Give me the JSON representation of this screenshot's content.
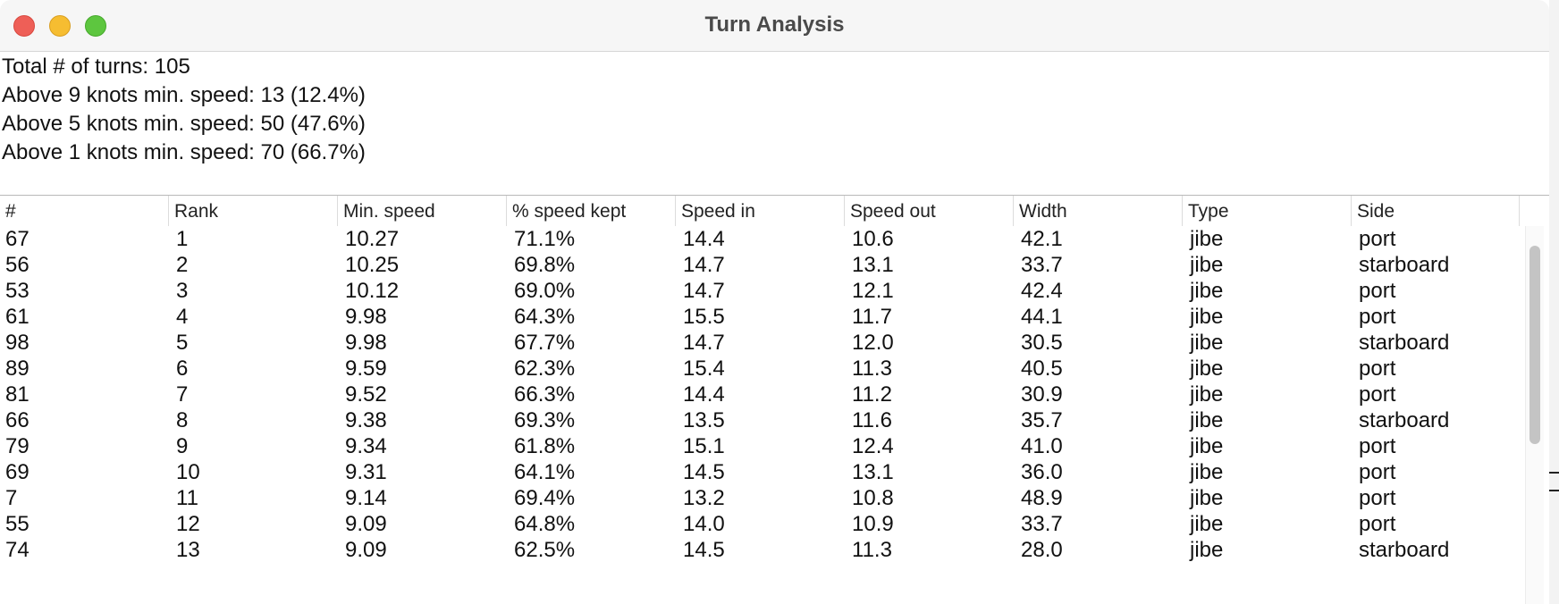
{
  "window": {
    "title": "Turn Analysis"
  },
  "summary": {
    "lines": [
      "Total # of turns: 105",
      "Above 9 knots min. speed: 13 (12.4%)",
      "Above 5 knots min. speed: 50 (47.6%)",
      "Above 1 knots min. speed: 70 (66.7%)"
    ]
  },
  "table": {
    "columns": [
      "#",
      "Rank",
      "Min. speed",
      "% speed kept",
      "Speed in",
      "Speed out",
      "Width",
      "Type",
      "Side"
    ],
    "rows": [
      [
        "67",
        "1",
        "10.27",
        "71.1%",
        "14.4",
        "10.6",
        "42.1",
        "jibe",
        "port"
      ],
      [
        "56",
        "2",
        "10.25",
        "69.8%",
        "14.7",
        "13.1",
        "33.7",
        "jibe",
        "starboard"
      ],
      [
        "53",
        "3",
        "10.12",
        "69.0%",
        "14.7",
        "12.1",
        "42.4",
        "jibe",
        "port"
      ],
      [
        "61",
        "4",
        "9.98",
        "64.3%",
        "15.5",
        "11.7",
        "44.1",
        "jibe",
        "port"
      ],
      [
        "98",
        "5",
        "9.98",
        "67.7%",
        "14.7",
        "12.0",
        "30.5",
        "jibe",
        "starboard"
      ],
      [
        "89",
        "6",
        "9.59",
        "62.3%",
        "15.4",
        "11.3",
        "40.5",
        "jibe",
        "port"
      ],
      [
        "81",
        "7",
        "9.52",
        "66.3%",
        "14.4",
        "11.2",
        "30.9",
        "jibe",
        "port"
      ],
      [
        "66",
        "8",
        "9.38",
        "69.3%",
        "13.5",
        "11.6",
        "35.7",
        "jibe",
        "starboard"
      ],
      [
        "79",
        "9",
        "9.34",
        "61.8%",
        "15.1",
        "12.4",
        "41.0",
        "jibe",
        "port"
      ],
      [
        "69",
        "10",
        "9.31",
        "64.1%",
        "14.5",
        "13.1",
        "36.0",
        "jibe",
        "port"
      ],
      [
        "7",
        "11",
        "9.14",
        "69.4%",
        "13.2",
        "10.8",
        "48.9",
        "jibe",
        "port"
      ],
      [
        "55",
        "12",
        "9.09",
        "64.8%",
        "14.0",
        "10.9",
        "33.7",
        "jibe",
        "port"
      ],
      [
        "74",
        "13",
        "9.09",
        "62.5%",
        "14.5",
        "11.3",
        "28.0",
        "jibe",
        "starboard"
      ]
    ]
  },
  "colors": {
    "close": "#ee5f57",
    "minimize": "#f6bd31",
    "zoom": "#5dc63f"
  }
}
